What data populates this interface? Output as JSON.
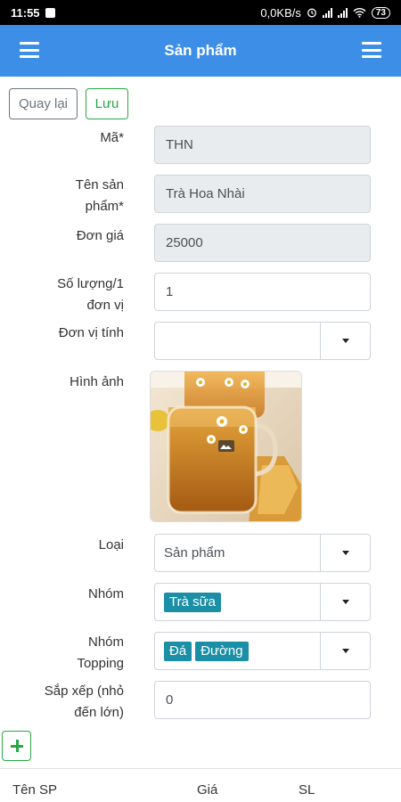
{
  "status_bar": {
    "time": "11:55",
    "net_speed": "0,0KB/s",
    "battery": "73",
    "icons": [
      "bag-icon",
      "alarm-icon",
      "signal-icon",
      "wifi-icon",
      "battery-icon"
    ]
  },
  "app_bar": {
    "title": "Sản phẩm",
    "left_icon": "menu-icon",
    "right_icon": "menu-icon",
    "color": "#3d8ee6"
  },
  "toolbar": {
    "back_label": "Quay lại",
    "save_label": "Lưu"
  },
  "form": {
    "code": {
      "label": "Mã*",
      "value": "THN"
    },
    "name": {
      "label_line1": "Tên sản",
      "label_line2": "phẩm*",
      "value": "Trà Hoa Nhài"
    },
    "price": {
      "label": "Đơn giá",
      "value": "25000"
    },
    "qty_per_unit": {
      "label_line1": "Số lượng/1",
      "label_line2": "đơn vị",
      "value": "1"
    },
    "unit": {
      "label": "Đơn vị tính",
      "value": ""
    },
    "image": {
      "label": "Hình ảnh",
      "icon": "image-icon"
    },
    "type": {
      "label": "Loại",
      "value": "Sản phẩm"
    },
    "group": {
      "label": "Nhóm",
      "tags": [
        "Trà sữa"
      ]
    },
    "topping": {
      "label_line1": "Nhóm",
      "label_line2": "Topping",
      "tags": [
        "Đá",
        "Đường"
      ]
    },
    "sort": {
      "label_line1": "Sắp xếp (nhỏ",
      "label_line2": "đến lớn)",
      "value": "0"
    }
  },
  "add_button_icon": "plus-icon",
  "table": {
    "headers": [
      "Tên SP",
      "Giá",
      "SL"
    ]
  },
  "colors": {
    "accent": "#3d8ee6",
    "success": "#28a745",
    "tag": "#1b8fa6",
    "readonly_bg": "#e9ecef"
  }
}
